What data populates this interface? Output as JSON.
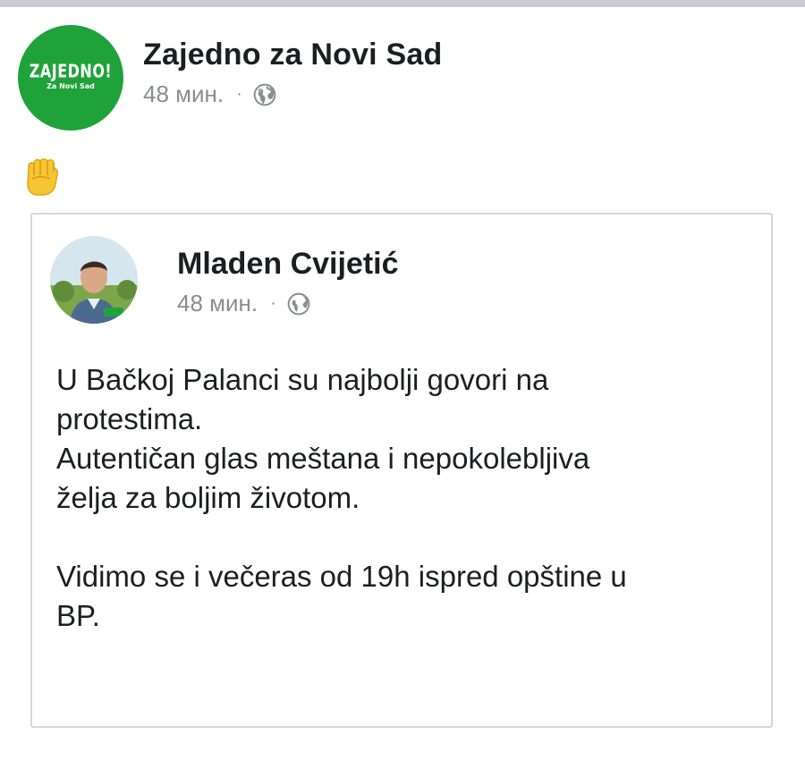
{
  "page": {
    "name": "Zajedno za Novi Sad",
    "time": "48 мин.",
    "separator": "·",
    "visibility_icon": "globe-icon",
    "avatar": {
      "logo_main": "ZAJEDNO!",
      "logo_sub": "Za Novi Sad",
      "color": "#1fa23a"
    }
  },
  "post": {
    "emoji": "raised-fist-emoji"
  },
  "shared_post": {
    "author": "Mladen Cvijetić",
    "time": "48 мин.",
    "separator": "·",
    "visibility_icon": "globe-icon",
    "body": {
      "line1": "U Bačkoj Palanci su najbolji govori na",
      "line2": "protestima.",
      "line3": "Autentičan glas meštana i nepokolebljiva",
      "line4": "želja za boljim životom.",
      "line5": "Vidimo se i večeras od 19h ispred opštine u",
      "line6": "BP."
    }
  },
  "colors": {
    "text": "#1c1e21",
    "meta": "#8a8d91",
    "border": "#d5d7da",
    "brand_green": "#1fa23a"
  }
}
